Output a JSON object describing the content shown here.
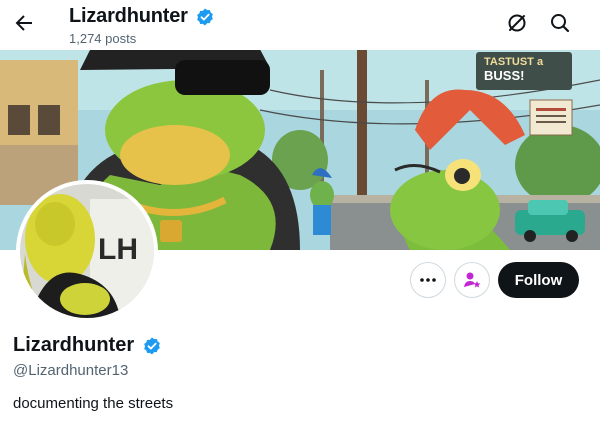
{
  "header": {
    "title": "Lizardhunter",
    "posts_count": "1,274 posts",
    "back_icon": "arrow-left-icon",
    "action_icons": [
      "grok-icon",
      "search-icon"
    ]
  },
  "banner": {
    "signs": [
      "TASTUST a",
      "BUSS!"
    ]
  },
  "avatar": {
    "text": "LH"
  },
  "actions": {
    "more_icon": "more-horizontal-icon",
    "subscribe_icon": "subscribe-icon",
    "follow_label": "Follow"
  },
  "profile": {
    "name": "Lizardhunter",
    "handle": "@Lizardhunter13",
    "bio": "documenting the streets"
  },
  "colors": {
    "verified": "#1d9bf0",
    "follow_bg": "#0f1419",
    "subscribe": "#c026d3",
    "muted_text": "#536471"
  }
}
